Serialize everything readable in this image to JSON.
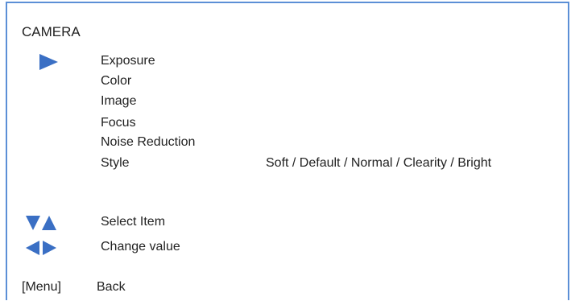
{
  "menu": {
    "title": "CAMERA",
    "items": [
      {
        "label": "Exposure"
      },
      {
        "label": "Color"
      },
      {
        "label": "Image"
      },
      {
        "label": "Focus"
      },
      {
        "label": "Noise Reduction"
      },
      {
        "label": "Style",
        "value": "Soft / Default / Normal / Clearity / Bright"
      }
    ],
    "selected_index": 0
  },
  "hints": {
    "select_item": "Select Item",
    "change_value": "Change value"
  },
  "footer": {
    "menu_key": "[Menu]",
    "back": "Back"
  },
  "icons": {
    "cursor": "right-triangle-icon",
    "select": "up-down-triangles-icon",
    "change": "left-right-triangles-icon"
  },
  "colors": {
    "accent": "#3a6fc4",
    "border": "#5b8fd6",
    "text": "#222222",
    "background": "#ffffff"
  }
}
